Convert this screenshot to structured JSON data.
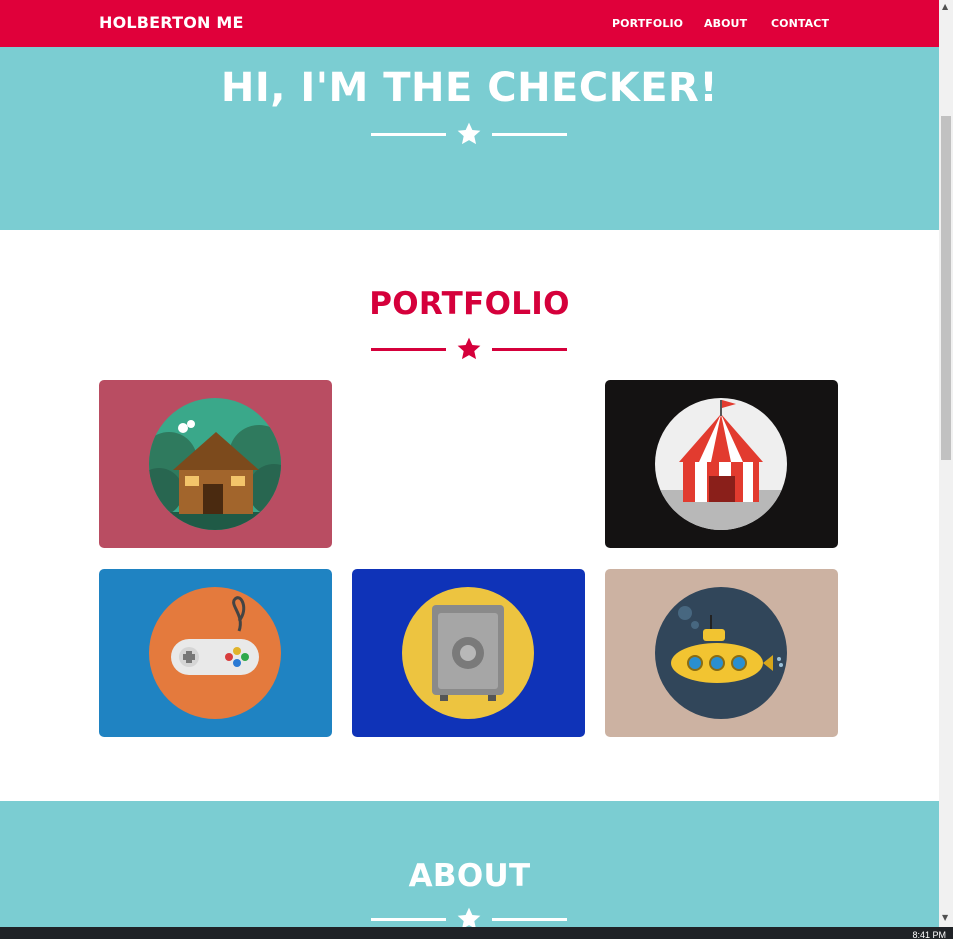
{
  "nav": {
    "brand": "HOLBERTON ME",
    "links": [
      "PORTFOLIO",
      "ABOUT",
      "CONTACT"
    ]
  },
  "hero": {
    "title": "HI, I'M THE CHECKER!"
  },
  "portfolio": {
    "title": "PORTFOLIO",
    "items": [
      {
        "name": "cabin",
        "bg": "#b94d62"
      },
      {
        "name": "circus-tent",
        "bg": "#141212"
      },
      {
        "name": "game-controller",
        "bg": "#1f83c2"
      },
      {
        "name": "safe",
        "bg": "#0f33b8"
      },
      {
        "name": "submarine",
        "bg": "#ccb2a2"
      }
    ]
  },
  "about": {
    "title": "ABOUT"
  },
  "taskbar": {
    "clock": "8:41 PM"
  },
  "colors": {
    "navbar": "#e0003a",
    "hero": "#7bcdd2",
    "accent": "#d5003b",
    "white": "#ffffff"
  },
  "icons": {
    "divider": "star-icon",
    "scroll_up": "scroll-up-arrow-icon",
    "scroll_down": "scroll-down-arrow-icon"
  }
}
